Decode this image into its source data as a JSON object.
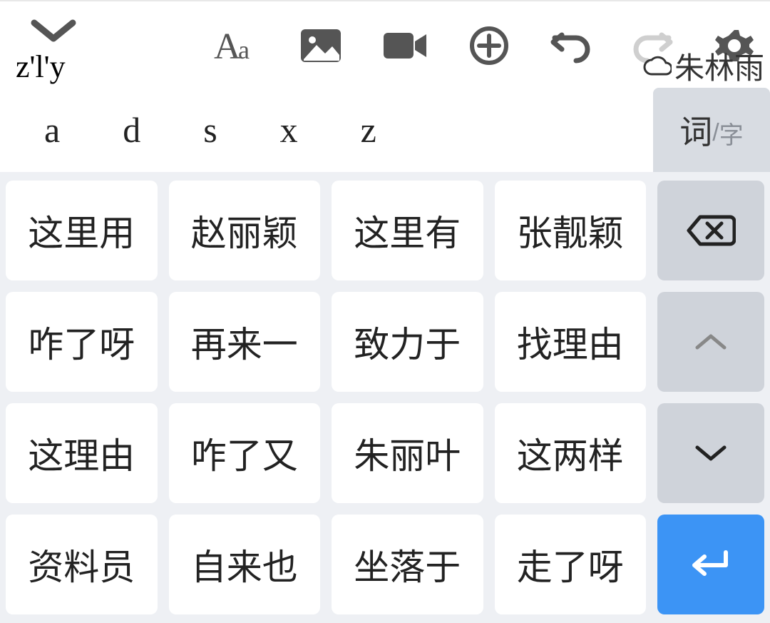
{
  "toolbar": {
    "pinyin": "z'l'y",
    "user_name": "朱林雨"
  },
  "letter_hints": [
    "a",
    "d",
    "s",
    "x",
    "z"
  ],
  "mode_toggle": {
    "primary": "词",
    "separator": "/",
    "secondary": "字"
  },
  "candidates": [
    "这里用",
    "赵丽颖",
    "这里有",
    "张靓颖",
    "咋了呀",
    "再来一",
    "致力于",
    "找理由",
    "这理由",
    "咋了又",
    "朱丽叶",
    "这两样",
    "资料员",
    "自来也",
    "坐落于",
    "走了呀"
  ]
}
